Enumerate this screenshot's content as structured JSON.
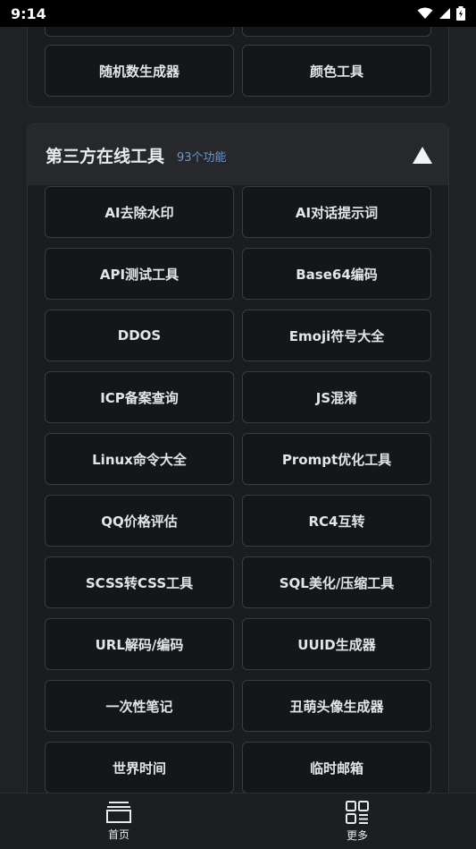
{
  "status_bar": {
    "time": "9:14"
  },
  "prev_section": {
    "tools": [
      "随机数生成器",
      "颜色工具"
    ]
  },
  "section": {
    "title": "第三方在线工具",
    "count": "93个功能",
    "tools": [
      "AI去除水印",
      "AI对话提示词",
      "API测试工具",
      "Base64编码",
      "DDOS",
      "Emoji符号大全",
      "ICP备案查询",
      "JS混淆",
      "Linux命令大全",
      "Prompt优化工具",
      "QQ价格评估",
      "RC4互转",
      "SCSS转CSS工具",
      "SQL美化/压缩工具",
      "URL解码/编码",
      "UUID生成器",
      "一次性笔记",
      "丑萌头像生成器",
      "世界时间",
      "临时邮箱"
    ]
  },
  "bottom_nav": {
    "items": [
      {
        "label": "首页",
        "icon": "home-icon"
      },
      {
        "label": "更多",
        "icon": "grid-icon"
      }
    ]
  }
}
